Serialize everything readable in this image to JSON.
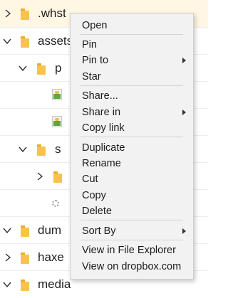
{
  "tree": {
    "rows": [
      {
        "name": ".whst",
        "expanded": false
      },
      {
        "name": "assets",
        "expanded": true
      },
      {
        "name": "p",
        "expanded": true
      },
      {
        "name": "",
        "type": "image"
      },
      {
        "name": "",
        "type": "image"
      },
      {
        "name": "s",
        "expanded": true
      },
      {
        "name": "",
        "expanded": false
      },
      {
        "name": "",
        "type": "file"
      },
      {
        "name": "dum",
        "expanded": true
      },
      {
        "name": "haxe",
        "expanded": false
      },
      {
        "name": "media",
        "expanded": true
      }
    ]
  },
  "context_menu": {
    "open": "Open",
    "pin": "Pin",
    "pin_to": "Pin to",
    "star": "Star",
    "share": "Share...",
    "share_in": "Share in",
    "copy_link": "Copy link",
    "duplicate": "Duplicate",
    "rename": "Rename",
    "cut": "Cut",
    "copy": "Copy",
    "delete": "Delete",
    "sort_by": "Sort By",
    "view_in_explorer": "View in File Explorer",
    "view_on_dropbox": "View on dropbox.com"
  },
  "colors": {
    "folder": "#f7c34c",
    "row_highlight": "#fff6e3",
    "menu_background": "#f2f2f2"
  },
  "icons": [
    "chevron-right-icon",
    "chevron-down-icon",
    "folder-icon",
    "image-file-icon",
    "settings-file-icon",
    "submenu-arrow-icon"
  ]
}
